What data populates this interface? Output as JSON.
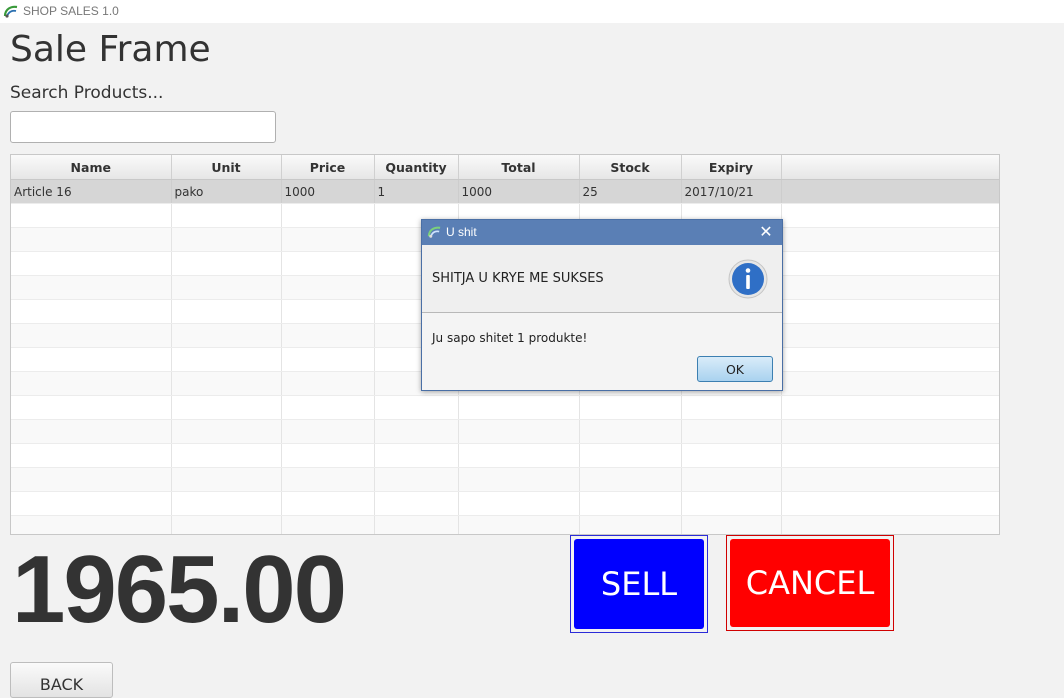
{
  "window": {
    "title": "SHOP SALES 1.0",
    "icon": "app-logo-icon"
  },
  "page": {
    "title": "Sale Frame",
    "search_label": "Search Products...",
    "search_value": "",
    "search_placeholder": ""
  },
  "table": {
    "columns": [
      "Name",
      "Unit",
      "Price",
      "Quantity",
      "Total",
      "Stock",
      "Expiry"
    ],
    "rows": [
      [
        "Article 16",
        "pako",
        "1000",
        "1",
        "1000",
        "25",
        "2017/10/21"
      ]
    ]
  },
  "total": "1965.00",
  "buttons": {
    "sell": "SELL",
    "cancel": "CANCEL",
    "back": "BACK"
  },
  "colors": {
    "sell": "#0000ff",
    "cancel": "#ff0000",
    "dialog_title": "#5a7fb5"
  },
  "dialog": {
    "title": "U shit",
    "header": "SHITJA U KRYE ME SUKSES",
    "message": "Ju sapo shitet 1 produkte!",
    "ok": "OK",
    "close_icon": "close-icon",
    "info_icon": "info-icon"
  }
}
